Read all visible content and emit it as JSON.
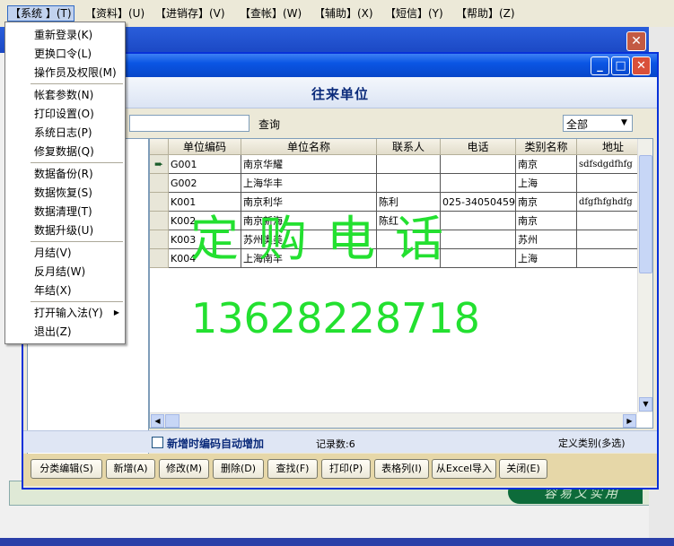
{
  "menubar": {
    "items": [
      "【系统 】(T)",
      "【资料】(U)",
      "【进销存】(V)",
      "【查帐】(W)",
      "【辅助】(X)",
      "【短信】(Y)",
      "【帮助】(Z)"
    ]
  },
  "system_menu": {
    "items": [
      "重新登录(K)",
      "更换口令(L)",
      "操作员及权限(M)",
      "帐套参数(N)",
      "打印设置(O)",
      "系统日志(P)",
      "修复数据(Q)",
      "数据备份(R)",
      "数据恢复(S)",
      "数据清理(T)",
      "数据升级(U)",
      "月结(V)",
      "反月结(W)",
      "年结(X)",
      "打开输入法(Y)",
      "退出(Z)"
    ]
  },
  "window": {
    "title": "往来单位",
    "search_label": "查询",
    "search_value": "",
    "filter_value": "全部"
  },
  "grid": {
    "columns": [
      "单位编码",
      "单位名称",
      "联系人",
      "电话",
      "类别名称",
      "地址"
    ],
    "rows": [
      [
        "G001",
        "南京华耀",
        "",
        "",
        "南京",
        "sdfsdgdfhfg"
      ],
      [
        "G002",
        "上海华丰",
        "",
        "",
        "上海",
        ""
      ],
      [
        "K001",
        "南京利华",
        "陈利",
        "025-34050459",
        "南京",
        "dfgfhfghdfg"
      ],
      [
        "K002",
        "南京新海",
        "陈红",
        "",
        "南京",
        ""
      ],
      [
        "K003",
        "苏州奥美",
        "",
        "",
        "苏州",
        ""
      ],
      [
        "K004",
        "上海南丰",
        "",
        "",
        "上海",
        ""
      ]
    ]
  },
  "status": {
    "auto_code_label": "新增时编码自动增加",
    "record_count": "记录数:6",
    "define_category": "定义类别(多选)"
  },
  "buttons": [
    "分类编辑(S)",
    "新增(A)",
    "修改(M)",
    "删除(D)",
    "查找(F)",
    "打印(P)",
    "表格列(I)",
    "从Excel导入",
    "关闭(E)"
  ],
  "watermark": {
    "line1": "定购电话",
    "line2": "13628228718"
  },
  "footer_banner": "容易又实用",
  "colors": {
    "accent": "#0a55e4",
    "watermark": "#23e030"
  }
}
